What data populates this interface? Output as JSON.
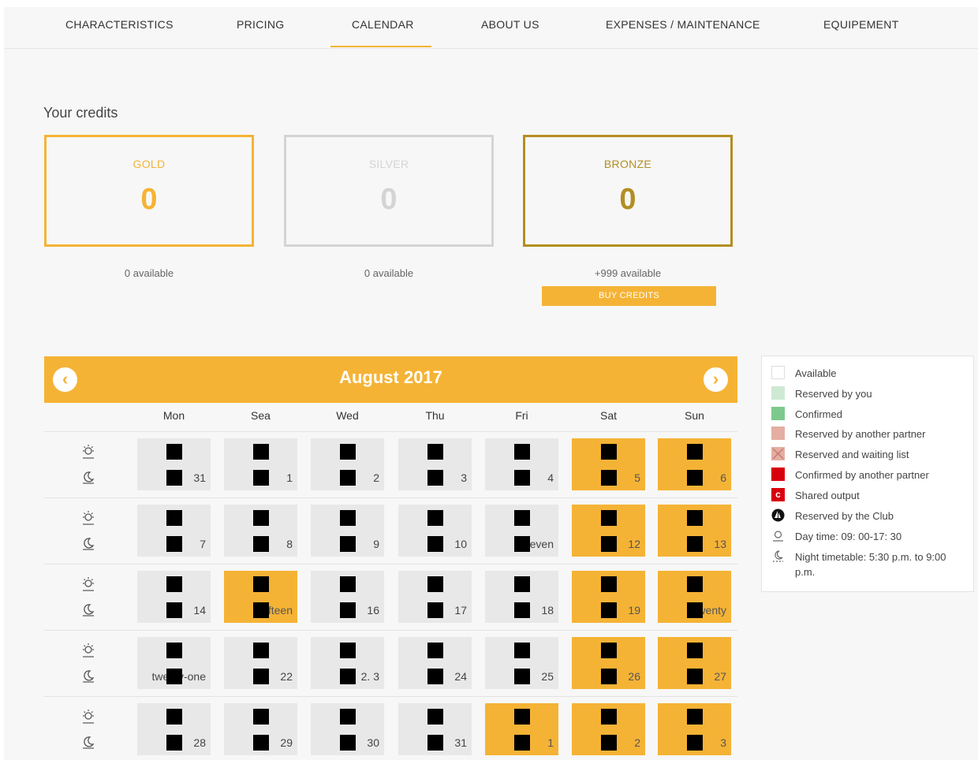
{
  "nav": {
    "items": [
      "CHARACTERISTICS",
      "PRICING",
      "CALENDAR",
      "ABOUT US",
      "EXPENSES / MAINTENANCE",
      "EQUIPEMENT"
    ],
    "active": "CALENDAR"
  },
  "credits": {
    "title": "Your credits",
    "boxes": [
      {
        "label": "GOLD",
        "value": "0",
        "available": "0 available",
        "color": "#f5b335"
      },
      {
        "label": "SILVER",
        "value": "0",
        "available": "0 available",
        "color": "#d4d4d4"
      },
      {
        "label": "BRONZE",
        "value": "0",
        "available": "+999 available",
        "color": "#b38e22"
      }
    ],
    "buy_label": "BUY CREDITS"
  },
  "calendar": {
    "title": "August 2017",
    "prev_icon": "chevron-left-icon",
    "next_icon": "chevron-right-icon",
    "days": [
      "Mon",
      "Sea",
      "Wed",
      "Thu",
      "Fri",
      "Sat",
      "Sun"
    ],
    "weeks": [
      [
        {
          "n": "31",
          "o": false
        },
        {
          "n": "1",
          "o": false
        },
        {
          "n": "2",
          "o": false
        },
        {
          "n": "3",
          "o": false
        },
        {
          "n": "4",
          "o": false
        },
        {
          "n": "5",
          "o": true
        },
        {
          "n": "6",
          "o": true
        }
      ],
      [
        {
          "n": "7",
          "o": false
        },
        {
          "n": "8",
          "o": false
        },
        {
          "n": "9",
          "o": false
        },
        {
          "n": "10",
          "o": false
        },
        {
          "n": "eleven",
          "o": false
        },
        {
          "n": "12",
          "o": true
        },
        {
          "n": "13",
          "o": true
        }
      ],
      [
        {
          "n": "14",
          "o": false
        },
        {
          "n": "fifteen",
          "o": true
        },
        {
          "n": "16",
          "o": false
        },
        {
          "n": "17",
          "o": false
        },
        {
          "n": "18",
          "o": false
        },
        {
          "n": "19",
          "o": true
        },
        {
          "n": "twenty",
          "o": true
        }
      ],
      [
        {
          "n": "twenty-one",
          "o": false
        },
        {
          "n": "22",
          "o": false
        },
        {
          "n": "2. 3",
          "o": false
        },
        {
          "n": "24",
          "o": false
        },
        {
          "n": "25",
          "o": false
        },
        {
          "n": "26",
          "o": true
        },
        {
          "n": "27",
          "o": true
        }
      ],
      [
        {
          "n": "28",
          "o": false
        },
        {
          "n": "29",
          "o": false
        },
        {
          "n": "30",
          "o": false
        },
        {
          "n": "31",
          "o": false
        },
        {
          "n": "1",
          "o": true
        },
        {
          "n": "2",
          "o": true
        },
        {
          "n": "3",
          "o": true
        }
      ]
    ]
  },
  "legend": [
    {
      "label": "Available",
      "swatch": "white",
      "color": "#ffffff"
    },
    {
      "label": "Reserved by you",
      "swatch": "fill",
      "color": "#cde9d4"
    },
    {
      "label": "Confirmed",
      "swatch": "fill",
      "color": "#7cc98e"
    },
    {
      "label": "Reserved by another partner",
      "swatch": "fill",
      "color": "#e4aea3"
    },
    {
      "label": "Reserved and waiting list",
      "swatch": "cross",
      "color": "#e4aea3"
    },
    {
      "label": "Confirmed by another partner",
      "swatch": "fill",
      "color": "#d8000c"
    },
    {
      "label": "Shared output",
      "swatch": "shared",
      "color": "#d8000c"
    },
    {
      "label": "Reserved by the Club",
      "swatch": "club",
      "color": "#111111"
    },
    {
      "label": "Day time: 09: 00-17: 30",
      "swatch": "sun",
      "color": "#666666"
    },
    {
      "label": "Night timetable: 5:30 p.m. to 9:00 p.m.",
      "swatch": "moon",
      "color": "#666666"
    }
  ]
}
